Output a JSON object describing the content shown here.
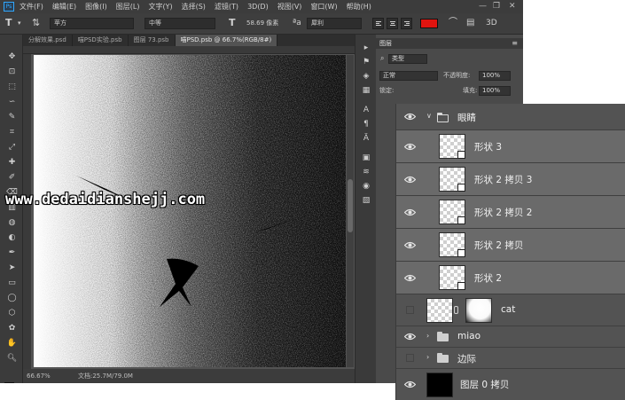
{
  "menu": [
    "文件(F)",
    "编辑(E)",
    "图像(I)",
    "图层(L)",
    "文字(Y)",
    "选择(S)",
    "滤镜(T)",
    "3D(D)",
    "视图(V)",
    "窗口(W)",
    "帮助(H)"
  ],
  "options": {
    "font_family": "苹方",
    "font_style": "中等",
    "font_size": "58.69 像素",
    "anti_alias": "犀利",
    "text_color": "#e0140f"
  },
  "tabs": [
    {
      "label": "分解效果.psd",
      "active": false
    },
    {
      "label": "喵PSD实验.psb",
      "active": false
    },
    {
      "label": "图层 73.psb",
      "active": false
    },
    {
      "label": "喵PSD.psb @ 66.7%(RGB/8#)",
      "active": true
    }
  ],
  "status": {
    "zoom": "66.67%",
    "doc": "文档:25.7M/79.0M"
  },
  "layers_panel": {
    "title": "图层",
    "filter_kind": "类型",
    "blend_mode": "正常",
    "opacity_label": "不透明度:",
    "opacity_value": "100%",
    "lock_label": "锁定:",
    "fill_label": "填充:",
    "fill_value": "100%"
  },
  "layers": [
    {
      "name": "眼睛",
      "type": "group",
      "expanded": true,
      "visible": true,
      "selected": false
    },
    {
      "name": "形状 3",
      "type": "shape",
      "visible": true,
      "selected": true
    },
    {
      "name": "形状 2 拷贝 3",
      "type": "shape",
      "visible": true,
      "selected": true
    },
    {
      "name": "形状 2 拷贝 2",
      "type": "shape",
      "visible": true,
      "selected": true
    },
    {
      "name": "形状 2 拷贝",
      "type": "shape",
      "visible": true,
      "selected": true
    },
    {
      "name": "形状 2",
      "type": "shape",
      "visible": true,
      "selected": true
    },
    {
      "name": "cat",
      "type": "masked",
      "visible": false,
      "selected": false
    },
    {
      "name": "miao",
      "type": "group",
      "expanded": false,
      "visible": true,
      "selected": false
    },
    {
      "name": "边际",
      "type": "group",
      "expanded": false,
      "visible": false,
      "selected": false
    },
    {
      "name": "图层 0 拷贝",
      "type": "fill",
      "visible": true,
      "selected": false
    }
  ],
  "watermark": "www.dedaidianshejj.com",
  "colors": {
    "foreground": "#d8201a",
    "background": "#ffffff",
    "accent": "#31a8ff"
  }
}
